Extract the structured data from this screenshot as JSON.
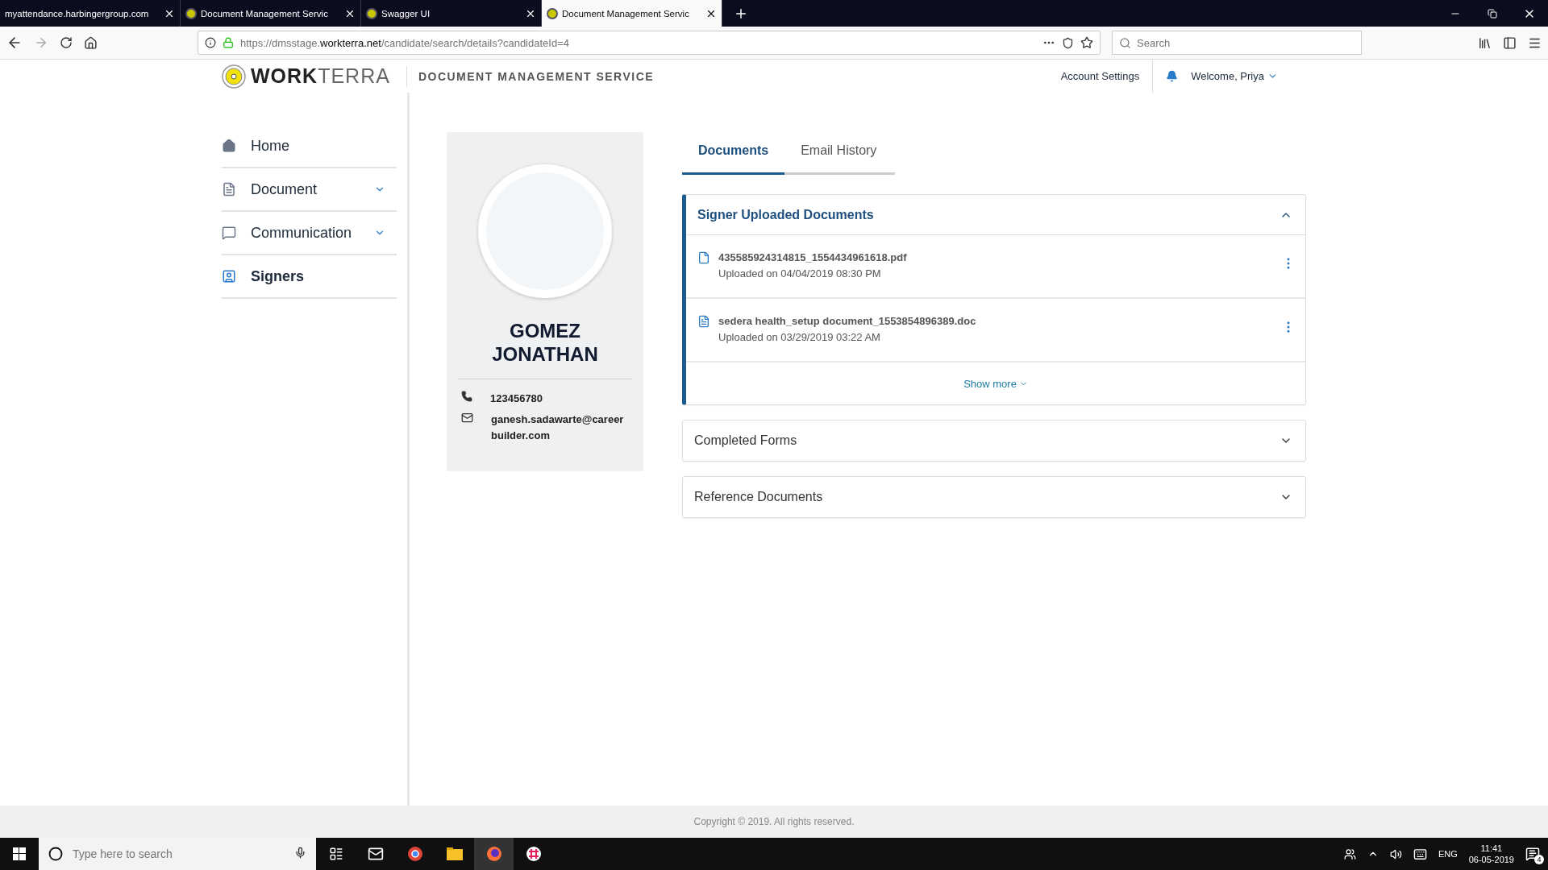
{
  "browser": {
    "tabs": [
      {
        "title": "myattendance.harbingergroup.com",
        "selected": false,
        "favicon": false
      },
      {
        "title": "Document Management Servic",
        "selected": false,
        "favicon": true
      },
      {
        "title": "Swagger UI",
        "selected": false,
        "favicon": true
      },
      {
        "title": "Document Management Servic",
        "selected": true,
        "favicon": true
      }
    ],
    "url": {
      "before": "https://dmsstage.",
      "domain": "workterra.net",
      "after": "/candidate/search/details?candidateId=4"
    },
    "search": {
      "placeholder": "Search"
    }
  },
  "header": {
    "logo_bold": "WORK",
    "logo_light": "TERRA",
    "service": "DOCUMENT MANAGEMENT SERVICE",
    "account": "Account Settings",
    "welcome": "Welcome, Priya"
  },
  "sidebar": {
    "items": [
      {
        "label": "Home",
        "kind": "home",
        "expandable": false,
        "selected": false
      },
      {
        "label": "Document",
        "kind": "document",
        "expandable": true,
        "selected": false
      },
      {
        "label": "Communication",
        "kind": "chat",
        "expandable": true,
        "selected": false
      },
      {
        "label": "Signers",
        "kind": "signer",
        "expandable": false,
        "selected": true
      }
    ]
  },
  "profile": {
    "first": "GOMEZ",
    "last": "JONATHAN",
    "phone": "123456780",
    "email": "ganesh.sadawarte@careerbuilder.com"
  },
  "tabs": [
    {
      "label": "Documents",
      "selected": true
    },
    {
      "label": "Email History",
      "selected": false
    }
  ],
  "sections": [
    {
      "title": "Signer Uploaded Documents",
      "expanded": true,
      "documents": [
        {
          "name": "435585924314815_1554434961618.pdf",
          "uploaded": "Uploaded on 04/04/2019 08:30 PM",
          "kind": "pdf"
        },
        {
          "name": "sedera health_setup document_1553854896389.doc",
          "uploaded": "Uploaded on 03/29/2019 03:22 AM",
          "kind": "doc"
        }
      ],
      "show_more": "Show more"
    },
    {
      "title": "Completed Forms",
      "expanded": false
    },
    {
      "title": "Reference Documents",
      "expanded": false
    }
  ],
  "footer": "Copyright © 2019. All rights reserved.",
  "taskbar": {
    "search_placeholder": "Type here to search",
    "language": "ENG",
    "time": "11:41",
    "date": "06-05-2019",
    "notifications": "4"
  }
}
